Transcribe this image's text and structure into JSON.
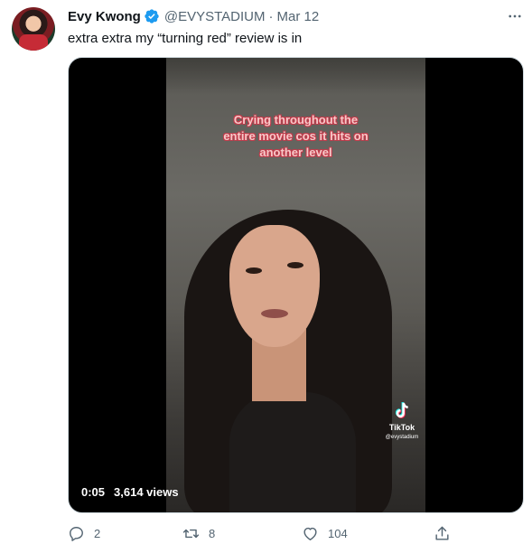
{
  "tweet": {
    "author": {
      "name": "Evy Kwong",
      "handle": "@EVYSTADIUM",
      "verified": true,
      "avatar_icon": "avatar"
    },
    "separator": "·",
    "date": "Mar 12",
    "text": "extra extra my “turning red” review is in",
    "more_icon": "more-horizontal-icon"
  },
  "media": {
    "type": "video",
    "caption_lines": [
      "Crying throughout the",
      "entire movie cos it hits on",
      "another level"
    ],
    "watermark": {
      "brand": "TikTok",
      "user": "@evystadium"
    },
    "timestamp": "0:05",
    "views": "3,614 views"
  },
  "actions": {
    "reply": {
      "icon": "reply-icon",
      "count": "2"
    },
    "retweet": {
      "icon": "retweet-icon",
      "count": "8"
    },
    "like": {
      "icon": "heart-icon",
      "count": "104"
    },
    "share": {
      "icon": "share-icon"
    }
  },
  "colors": {
    "text_primary": "#0f1419",
    "text_secondary": "#536471",
    "verified_blue": "#1d9bf0",
    "caption_pink": "#f7c8c8",
    "caption_outline": "#c03a4a"
  }
}
